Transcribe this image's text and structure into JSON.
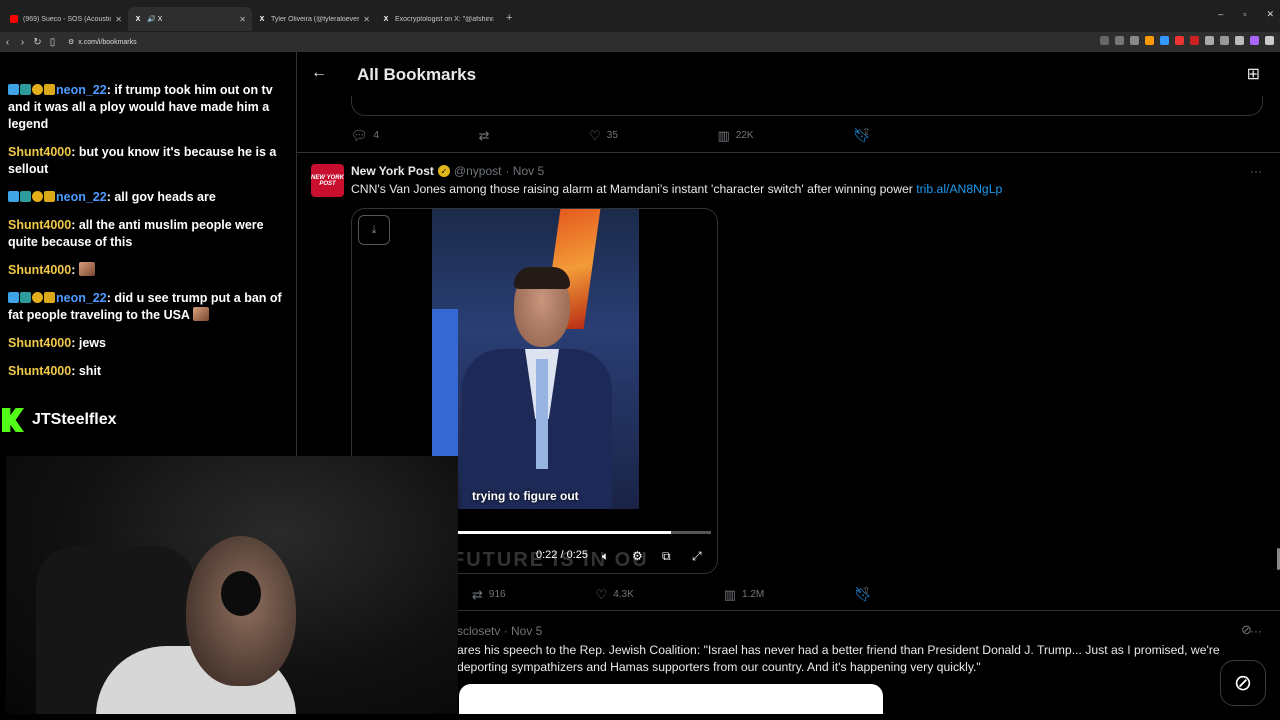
{
  "browser": {
    "tabs": [
      {
        "title": "(969) Sueco - SOS (Acoustic) (Officia",
        "favicon_color": "#ff0000"
      },
      {
        "title": "🔊 X",
        "favicon_color": "#ffffff"
      },
      {
        "title": "Tyler Oliveira (@tyleraloevera) / X",
        "favicon_color": "#ffffff"
      },
      {
        "title": "Exocryptologist on X: \"@afshinrattan",
        "favicon_color": "#ffffff"
      }
    ],
    "url": "x.com/i/bookmarks",
    "new_tab": "+",
    "window_controls": [
      "–",
      "▫",
      "✕"
    ]
  },
  "chat": {
    "messages": [
      {
        "user": "neon_22",
        "text": ": if trump took him out on tv and it was all a ploy would have made him a legend",
        "badges": true
      },
      {
        "user": "Shunt4000",
        "text": ": but you know it's because he is a sellout",
        "badges": false
      },
      {
        "user": "neon_22",
        "text": ": all gov heads are",
        "badges": true
      },
      {
        "user": "Shunt4000",
        "text": ": all the anti muslim people were quite because of this",
        "badges": false
      },
      {
        "user": "Shunt4000",
        "text": ": ",
        "badges": false,
        "emote": true
      },
      {
        "user": "neon_22",
        "text": ": did u see trump put a ban of fat people traveling to the USA ",
        "badges": true,
        "emote": true
      },
      {
        "user": "Shunt4000",
        "text": ": jews",
        "badges": false
      },
      {
        "user": "Shunt4000",
        "text": ": shit",
        "badges": false
      }
    ],
    "brand_name": "JTSteelflex",
    "colors": {
      "neon": "#4d9bff",
      "shunt": "#f0c94a",
      "kick": "#53fc18"
    }
  },
  "header": {
    "title": "All Bookmarks"
  },
  "prev_tweet": {
    "replies": "4",
    "likes": "35",
    "views": "22K"
  },
  "tweet": {
    "avatar_text": "NEW YORK POST",
    "name": "New York Post",
    "handle": "@nypost",
    "date": "· Nov 5",
    "text": "CNN's Van Jones among those raising alarm at Mamdani's instant 'character switch' after winning power ",
    "link": "trib.al/AN8NgLp",
    "video": {
      "caption": "trying to figure out",
      "time": "0:22 / 0:25",
      "progress": 0.84,
      "banner": "FUTURE IS IN OU"
    },
    "retweets": "916",
    "likes": "4.3K",
    "views": "1.2M"
  },
  "next_tweet": {
    "handle": "sclosetv · Nov 5",
    "text": "ares his speech to the Rep. Jewish Coalition: \"Israel has never had a better friend than President Donald J. Trump... Just as I promised, we're deporting sympathizers and Hamas supporters from our country. And it's happening very quickly.\""
  },
  "accent": "#1d9bf0"
}
